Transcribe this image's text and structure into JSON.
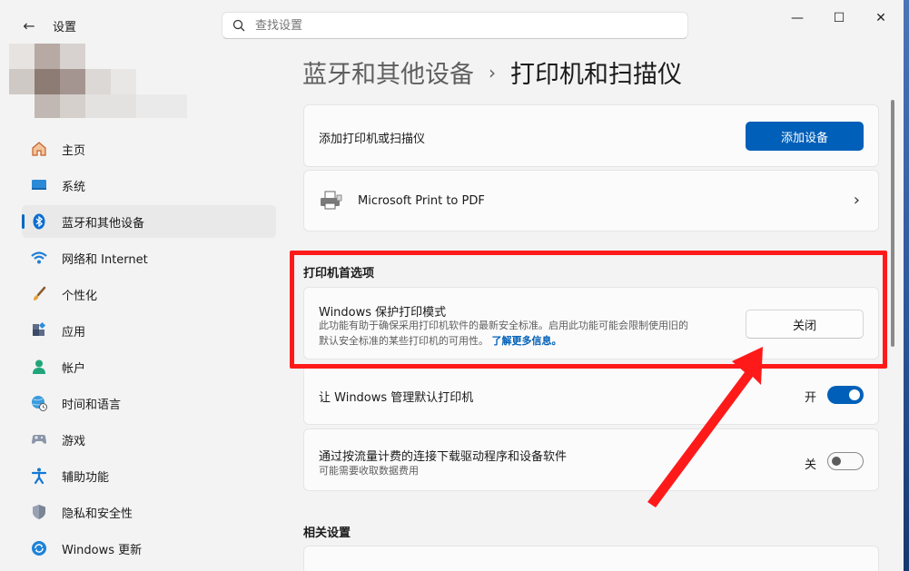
{
  "titlebar": {
    "app_title": "设置",
    "search_placeholder": "查找设置",
    "minimize": "—",
    "maximize": "☐",
    "close": "✕"
  },
  "sidebar": {
    "items": [
      {
        "label": "主页",
        "icon": "home-icon"
      },
      {
        "label": "系统",
        "icon": "system-icon"
      },
      {
        "label": "蓝牙和其他设备",
        "icon": "bluetooth-icon",
        "active": true
      },
      {
        "label": "网络和 Internet",
        "icon": "wifi-icon"
      },
      {
        "label": "个性化",
        "icon": "brush-icon"
      },
      {
        "label": "应用",
        "icon": "apps-icon"
      },
      {
        "label": "帐户",
        "icon": "account-icon"
      },
      {
        "label": "时间和语言",
        "icon": "globe-clock-icon"
      },
      {
        "label": "游戏",
        "icon": "gamepad-icon"
      },
      {
        "label": "辅助功能",
        "icon": "accessibility-icon"
      },
      {
        "label": "隐私和安全性",
        "icon": "shield-icon"
      },
      {
        "label": "Windows 更新",
        "icon": "update-icon"
      }
    ]
  },
  "breadcrumb": {
    "parent": "蓝牙和其他设备",
    "separator": "›",
    "current": "打印机和扫描仪"
  },
  "add_printer": {
    "label": "添加打印机或扫描仪",
    "button": "添加设备"
  },
  "printer": {
    "name": "Microsoft Print to PDF",
    "chevron": "›"
  },
  "preferences": {
    "heading": "打印机首选项",
    "protected_mode": {
      "title": "Windows 保护打印模式",
      "desc_line1": "此功能有助于确保采用打印机软件的最新安全标准。启用此功能可能会限制使用旧的",
      "desc_line2": "默认安全标准的某些打印机的可用性。",
      "link": "了解更多信息。",
      "button": "关闭"
    },
    "manage_default": {
      "title": "让 Windows 管理默认打印机",
      "state": "开",
      "on": true
    },
    "metered": {
      "title": "通过按流量计费的连接下载驱动程序和设备软件",
      "subtitle": "可能需要收取数据费用",
      "state": "关",
      "on": false
    }
  },
  "related": {
    "heading": "相关设置"
  },
  "colors": {
    "accent": "#005fb8",
    "highlight": "#ff1a1a"
  }
}
